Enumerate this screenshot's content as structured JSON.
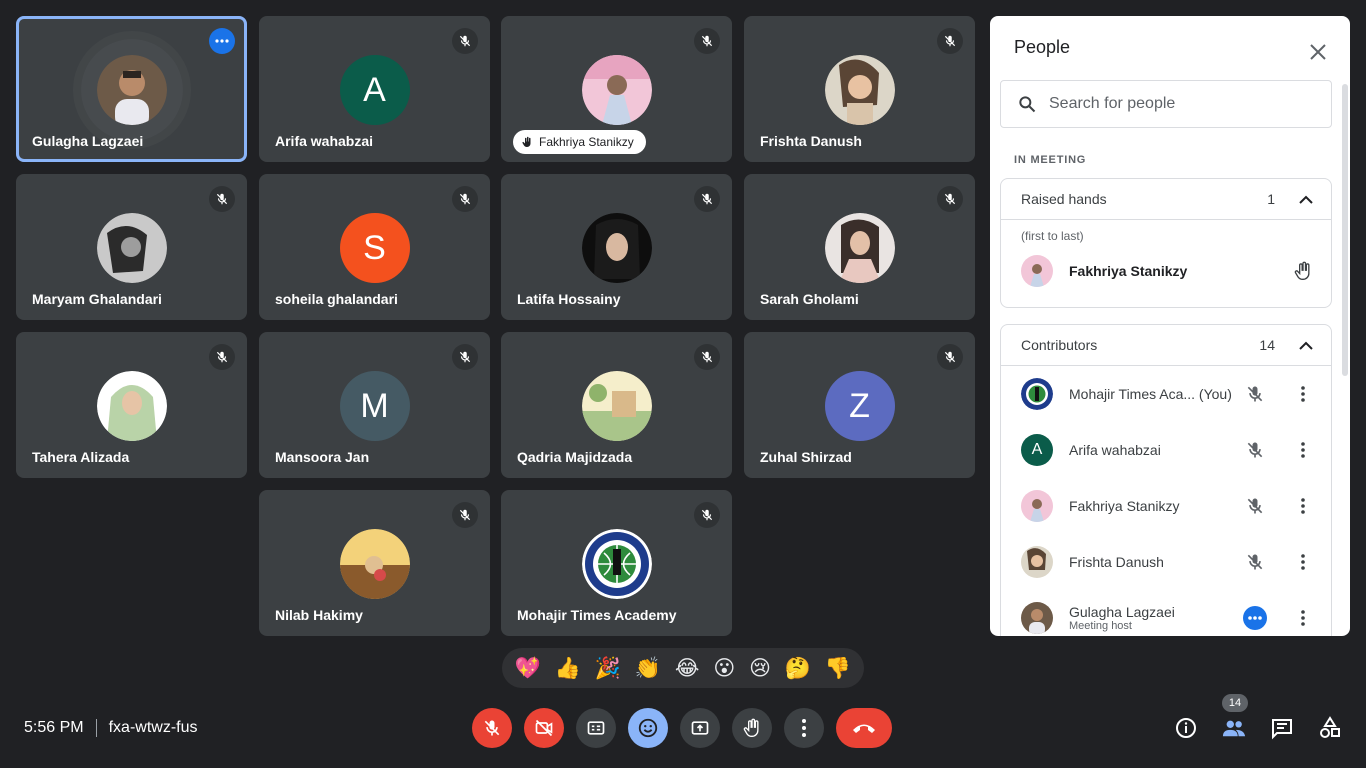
{
  "tiles": [
    {
      "name": "Gulagha Lagzaei",
      "type": "photo",
      "muted": false
    },
    {
      "name": "Arifa wahabzai",
      "initial": "A",
      "color": "#0b5c4a"
    },
    {
      "name": "Fakhriya Stanikzy",
      "type": "photo"
    },
    {
      "name": "Frishta Danush",
      "type": "photo"
    },
    {
      "name": "Maryam Ghalandari",
      "type": "photo"
    },
    {
      "name": "soheila ghalandari",
      "initial": "S",
      "color": "#f4511e"
    },
    {
      "name": "Latifa Hossainy",
      "type": "photo"
    },
    {
      "name": "Sarah Gholami",
      "type": "photo"
    },
    {
      "name": "Tahera Alizada",
      "type": "photo"
    },
    {
      "name": "Mansoora Jan",
      "initial": "M",
      "color": "#455a64"
    },
    {
      "name": "Qadria Majidzada",
      "type": "photo"
    },
    {
      "name": "Zuhal Shirzad",
      "initial": "Z",
      "color": "#5c6bc0"
    },
    {
      "name": "Nilab Hakimy",
      "type": "photo"
    },
    {
      "name": "Mohajir Times Academy",
      "type": "logo"
    }
  ],
  "reactions": [
    "💖",
    "👍",
    "🎉",
    "👏",
    "😂",
    "😮",
    "😢",
    "🤔",
    "👎"
  ],
  "meeting": {
    "time": "5:56 PM",
    "code": "fxa-wtwz-fus"
  },
  "people_badge": "14",
  "panel": {
    "title": "People",
    "search_placeholder": "Search for people",
    "section_label": "IN MEETING",
    "raised_hands": {
      "label": "Raised hands",
      "count": "1",
      "note": "(first to last)",
      "people": [
        "Fakhriya Stanikzy"
      ]
    },
    "contributors": {
      "label": "Contributors",
      "count": "14",
      "people": [
        {
          "name": "Mohajir Times Aca...  (You)"
        },
        {
          "name": "Arifa wahabzai",
          "initial": "A"
        },
        {
          "name": "Fakhriya Stanikzy"
        },
        {
          "name": "Frishta Danush"
        },
        {
          "name": "Gulagha Lagzaei",
          "sub": "Meeting host"
        }
      ]
    }
  },
  "icons": {
    "mic_off": "mic-off-icon",
    "cam_off": "videocam-off-icon",
    "cc": "closed-caption-icon",
    "emoji": "emoji-icon",
    "present": "present-screen-icon",
    "hand": "raise-hand-icon",
    "more": "more-vert-icon",
    "end": "call-end-icon",
    "info": "info-icon",
    "people": "people-icon",
    "chat": "chat-icon",
    "activities": "activities-icon"
  }
}
